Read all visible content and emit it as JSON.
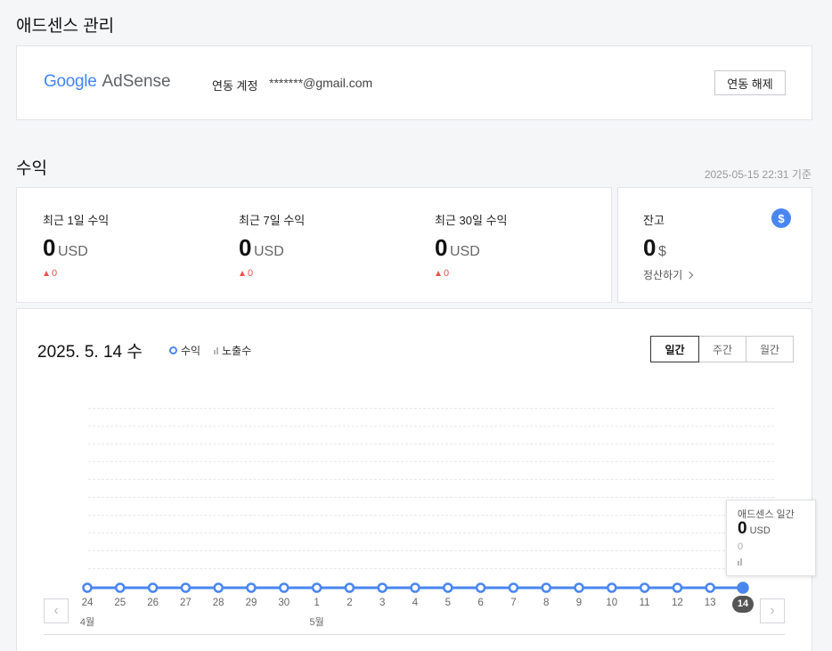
{
  "adsense_section": {
    "title": "애드센스 관리",
    "logo_google": "Google",
    "logo_adsense": "AdSense",
    "account_label": "연동 계정",
    "account_email": "*******@gmail.com",
    "unlink_button": "연동 해제"
  },
  "revenue_section": {
    "title": "수익",
    "timestamp": "2025-05-15 22:31 기준",
    "stats": [
      {
        "label": "최근 1일 수익",
        "value": "0",
        "unit": "USD",
        "delta": "0"
      },
      {
        "label": "최근 7일 수익",
        "value": "0",
        "unit": "USD",
        "delta": "0"
      },
      {
        "label": "최근 30일 수익",
        "value": "0",
        "unit": "USD",
        "delta": "0"
      }
    ],
    "balance": {
      "label": "잔고",
      "value": "0",
      "unit": "$",
      "settle_link": "정산하기",
      "icon": "dollar-icon",
      "icon_glyph": "$"
    }
  },
  "chart_panel": {
    "date_title": "2025. 5. 14 수",
    "legend_revenue": "수익",
    "legend_impressions": "노출수",
    "tabs": [
      "일간",
      "주간",
      "월간"
    ],
    "active_tab": "일간",
    "prev_arrow": "‹",
    "next_arrow": "›",
    "tooltip": {
      "title": "애드센스 일간",
      "value": "0",
      "unit": "USD",
      "sub_value": "0"
    }
  },
  "chart_data": {
    "type": "line",
    "x": [
      "24",
      "25",
      "26",
      "27",
      "28",
      "29",
      "30",
      "1",
      "2",
      "3",
      "4",
      "5",
      "6",
      "7",
      "8",
      "9",
      "10",
      "11",
      "12",
      "13",
      "14"
    ],
    "month_labels": [
      {
        "at": "24",
        "label": "4월"
      },
      {
        "at": "1",
        "label": "5월"
      }
    ],
    "series": [
      {
        "name": "수익",
        "values": [
          0,
          0,
          0,
          0,
          0,
          0,
          0,
          0,
          0,
          0,
          0,
          0,
          0,
          0,
          0,
          0,
          0,
          0,
          0,
          0,
          0
        ]
      },
      {
        "name": "노출수",
        "values": [
          0,
          0,
          0,
          0,
          0,
          0,
          0,
          0,
          0,
          0,
          0,
          0,
          0,
          0,
          0,
          0,
          0,
          0,
          0,
          0,
          0
        ]
      }
    ],
    "selected": "14",
    "grid": true,
    "colors": {
      "line": "#4a86f0",
      "selected_badge": "#555555",
      "impressions": "#b5b5b5"
    }
  }
}
